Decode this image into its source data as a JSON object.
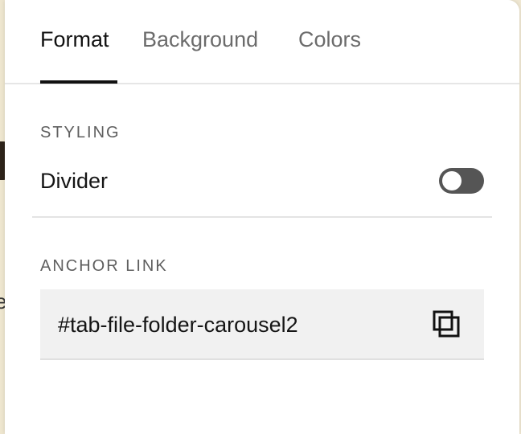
{
  "tabs": [
    {
      "label": "Format",
      "active": true
    },
    {
      "label": "Background",
      "active": false
    },
    {
      "label": "Colors",
      "active": false
    }
  ],
  "styling": {
    "section_label": "STYLING",
    "divider_label": "Divider",
    "divider_enabled": false
  },
  "anchor": {
    "section_label": "ANCHOR LINK",
    "value": "#tab-file-folder-carousel2",
    "copy_icon": "copy-icon"
  },
  "colors": {
    "toggle_off": "#555555",
    "input_bg": "#f1f1f1",
    "active_tab": "#111111",
    "inactive_tab": "#6b6b6b"
  }
}
